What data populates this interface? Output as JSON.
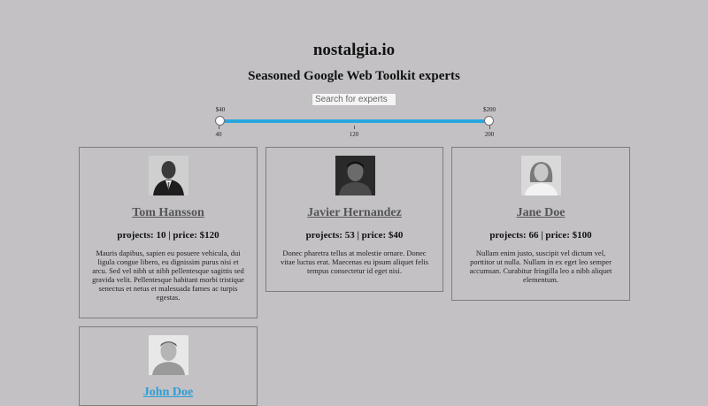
{
  "site": {
    "title": "nostalgia.io",
    "tagline": "Seasoned Google Web Toolkit experts"
  },
  "search": {
    "placeholder": "Search for experts"
  },
  "price_slider": {
    "min_label": "$40",
    "max_label": "$200",
    "ticks": [
      "40",
      "120",
      "200"
    ],
    "accent_color": "#2aa7df"
  },
  "experts": [
    {
      "name": "Tom Hansson",
      "stats": "projects: 10 | price: $120",
      "description": "Mauris dapibus, sapien eu posuere vehicula, dui ligula congue libero, eu dignissim purus nisi et arcu. Sed vel nibh ut nibh pellentesque sagittis sed gravida velit. Pellentesque habitant morbi tristique senectus et netus et malesuada fames ac turpis egestas."
    },
    {
      "name": "Javier Hernandez",
      "stats": "projects: 53 | price: $40",
      "description": "Donec pharetra tellus at molestie ornare. Donec vitae luctus erat. Maecenas eu ipsum aliquet felis tempus consectetur id eget nisi."
    },
    {
      "name": "Jane Doe",
      "stats": "projects: 66 | price: $100",
      "description": "Nullam enim justo, suscipit vel dictum vel, porttitor ut nulla. Nullam in ex eget leo semper accumsan. Curabitur fringilla leo a nibh aliquet elementum."
    },
    {
      "name": "John Doe"
    }
  ]
}
